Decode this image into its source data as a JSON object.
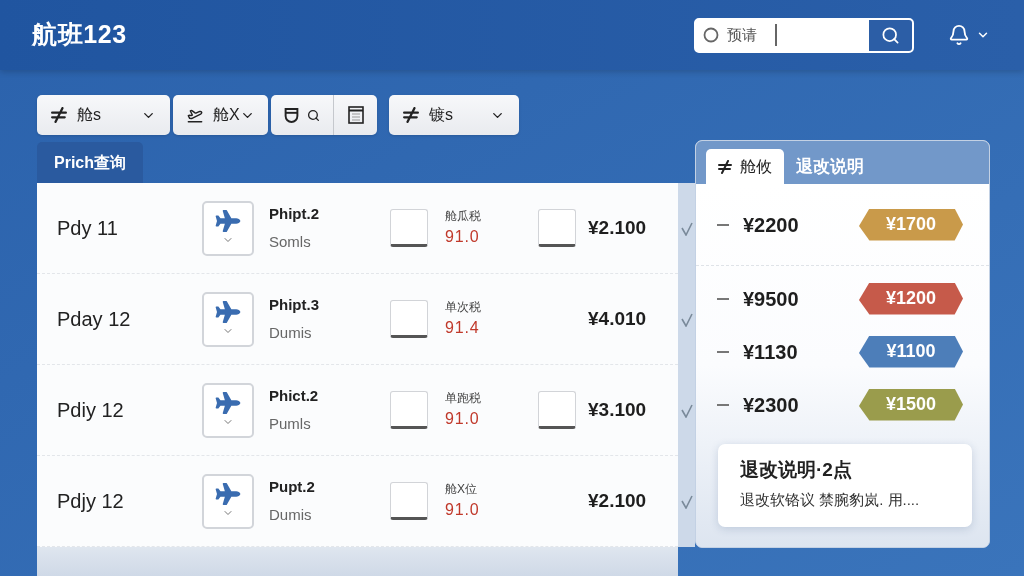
{
  "header": {
    "title": "航班123",
    "search": {
      "placeholder": "预请"
    }
  },
  "toolbar": [
    {
      "kind": "dropdown",
      "label": "舱s"
    },
    {
      "kind": "dropdown",
      "label": "舱X"
    },
    {
      "kind": "icons"
    },
    {
      "kind": "dropdown",
      "label": "镀s"
    }
  ],
  "list_tabs": [
    {
      "label": "Prich查询",
      "selected": true
    }
  ],
  "rows": [
    {
      "date": "Pdy 11",
      "flight": "Phipt.2",
      "subtitle": "Somls",
      "tax_checked": false,
      "tax_label": "舱瓜税",
      "tax": "91.0",
      "price_checked": false,
      "price": "¥2.100",
      "checked": true
    },
    {
      "date": "Pday 12",
      "flight": "Phipt.3",
      "subtitle": "Dumis",
      "tax_checked": false,
      "tax_label": "单次税",
      "tax": "91.4",
      "price": "¥4.010",
      "checked": true
    },
    {
      "date": "Pdiy 12",
      "flight": "Phict.2",
      "subtitle": "Pumls",
      "tax_checked": false,
      "tax_label": "单跑税",
      "tax": "91.0",
      "price_checked": false,
      "price": "¥3.100",
      "checked": true
    },
    {
      "date": "Pdjy 12",
      "flight": "Pupt.2",
      "subtitle": "Dumis",
      "tax_checked": false,
      "tax_label": "舱X位",
      "tax": "91.0",
      "price": "¥2.100",
      "checked": true
    }
  ],
  "side_panel": {
    "tabs": [
      {
        "label": "舱攸",
        "selected": true
      },
      {
        "label": "退改说明",
        "selected": false
      }
    ],
    "fares": [
      {
        "price": "¥2200",
        "tag": "¥1700",
        "color": "#c99a4a"
      },
      {
        "price": "¥9500",
        "tag": "¥1200",
        "color": "#c65a4a"
      },
      {
        "price": "¥1130",
        "tag": "¥1100",
        "color": "#4d7eb9"
      },
      {
        "price": "¥2300",
        "tag": "¥1500",
        "color": "#9a9c4c"
      }
    ],
    "note": {
      "title": "退改说明·2点",
      "text": "退改软铬议 禁腕豹岚. 用...."
    }
  }
}
